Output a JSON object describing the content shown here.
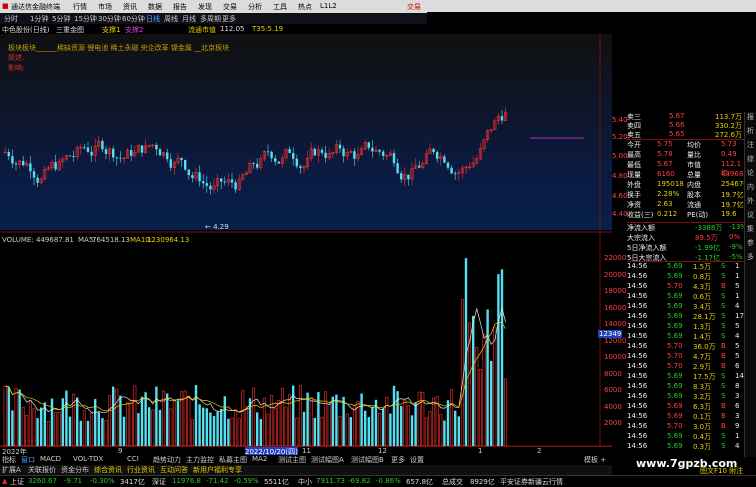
{
  "menubar": {
    "app": "通达信金融终端",
    "items": [
      "行情",
      "市场",
      "资讯",
      "数据",
      "报告",
      "发现",
      "交易",
      "分析",
      "工具",
      "热点",
      "L1L2"
    ],
    "right": "交易"
  },
  "toolbar": {
    "items": [
      "分时",
      "1分钟",
      "5分钟",
      "15分钟",
      "30分钟",
      "60分钟",
      "日线",
      "周线",
      "月线",
      "多周期",
      "更多"
    ]
  },
  "info": {
    "stock": "中色股份(日线)",
    "indicator": "三重金图",
    "b1": "支撑1",
    "b2": "支撑2",
    "mktval_label": "流通市值",
    "mktval": "112.05",
    "t35": "T35:5.19"
  },
  "note": {
    "l1": "板块板块______稀缺资源 锂电池 稀土永磁 央企改革 镍金属 __北京板块",
    "l2": "简述:",
    "l3": "影响:"
  },
  "price_axis": [
    "5.40",
    "5.20",
    "5.00",
    "4.80",
    "4.60",
    "4.40"
  ],
  "low_label": "← 4.29",
  "quote": {
    "asks": [
      [
        "卖三",
        "5.67",
        "113.7万"
      ],
      [
        "卖四",
        "5.66",
        "330.2万"
      ],
      [
        "卖五",
        "5.65",
        "272.6万"
      ]
    ],
    "rows": [
      [
        "今开",
        "5.75",
        "均价",
        "5.73"
      ],
      [
        "最高",
        "5.78",
        "量比",
        "0.49"
      ],
      [
        "最低",
        "5.67",
        "市值",
        "112.1亿"
      ],
      [
        "现量",
        "6160",
        "总量",
        "449688"
      ],
      [
        "外盘",
        "195018",
        "内盘",
        "254670"
      ],
      [
        "换手",
        "2.28%",
        "股本",
        "19.7亿"
      ],
      [
        "净资",
        "2.63",
        "流通",
        "19.7亿"
      ],
      [
        "收益(三)",
        "0.212",
        "PE(动)",
        "19.6"
      ]
    ]
  },
  "flow": [
    [
      "净流入额",
      "-3388万",
      "-13%"
    ],
    [
      "大宗流入",
      "89.5万",
      "0%"
    ],
    [
      "5日净流入额",
      "-1.99亿",
      "-9%"
    ],
    [
      "5日大宗流入",
      "-1.17亿",
      "-5%"
    ]
  ],
  "ticks": [
    [
      "14:56",
      "5.69",
      "1.5万",
      "S",
      "1"
    ],
    [
      "14:56",
      "5.69",
      "0.8万",
      "S",
      "1"
    ],
    [
      "14:56",
      "5.70",
      "4.3万",
      "B",
      "5"
    ],
    [
      "14:56",
      "5.69",
      "0.6万",
      "S",
      "1"
    ],
    [
      "14:56",
      "5.69",
      "3.4万",
      "S",
      "4"
    ],
    [
      "14:56",
      "5.69",
      "28.1万",
      "S",
      "17"
    ],
    [
      "14:56",
      "5.69",
      "1.3万",
      "S",
      "5"
    ],
    [
      "14:56",
      "5.69",
      "1.4万",
      "S",
      "4"
    ],
    [
      "14:56",
      "5.70",
      "36.0万",
      "B",
      "5"
    ],
    [
      "14:56",
      "5.70",
      "4.7万",
      "B",
      "5"
    ],
    [
      "14:56",
      "5.70",
      "2.9万",
      "B",
      "6"
    ],
    [
      "14:56",
      "5.69",
      "17.5万",
      "S",
      "14"
    ],
    [
      "14:56",
      "5.69",
      "8.3万",
      "S",
      "8"
    ],
    [
      "14:56",
      "5.69",
      "3.2万",
      "S",
      "3"
    ],
    [
      "14:56",
      "5.69",
      "6.3万",
      "B",
      "6"
    ],
    [
      "14:56",
      "5.69",
      "0.1万",
      "B",
      "3"
    ],
    [
      "14:56",
      "5.70",
      "3.0万",
      "B",
      "9"
    ],
    [
      "14:56",
      "5.69",
      "0.4万",
      "S",
      "1"
    ],
    [
      "14:56",
      "5.69",
      "0.3万",
      "S",
      "4"
    ]
  ],
  "vol": {
    "label": "VOLUME:",
    "v": "449687.81",
    "ma5l": "MA5:",
    "ma5": "764518.13",
    "ma10l": "MA10:",
    "ma10": "1230964.13"
  },
  "vol_axis": [
    "22000",
    "20000",
    "18000",
    "16000",
    "14000",
    "12000",
    "10000",
    "8000",
    "6000",
    "4000",
    "2000"
  ],
  "vol_marker": "12349",
  "xaxis": {
    "a": "2022年",
    "b": "9",
    "c": "10",
    "date": "2022/10/20(四)",
    "d": "11",
    "e": "12",
    "f": "1",
    "g": "2"
  },
  "tabs": [
    "指标",
    "窗口",
    "MACD",
    "VOL-TDX",
    "CCI",
    "趋势动力",
    "主力监控",
    "私募主图",
    "MA2",
    "测试主图",
    "测试幅图A",
    "测试幅图B",
    "更多",
    "设置"
  ],
  "tabs2": [
    "扩展A",
    "关联报价",
    "资金分布",
    "综合资讯",
    "行业资讯",
    "互动问答",
    "新用户福利专享"
  ],
  "tab_right": "模板 +",
  "status": {
    "sh": "上证",
    "shv": "3260.67",
    "shc": "-9.71",
    "shp": "-0.30%",
    "sha": "3417亿",
    "sz": "深证",
    "szv": "11976.8",
    "szc": "-71.42",
    "szp": "-0.59%",
    "sza": "5511亿",
    "zx": "中小",
    "zxv": "7911.73",
    "zxc": "-69.82",
    "zxp": "-0.86%",
    "zxa": "657.8亿",
    "zs": "总成交",
    "zsa": "8929亿",
    "broker": "平安证券新疆云行情"
  },
  "watermark": "www.7gpzb.com",
  "footnote": "图文F10 附注",
  "right_icons": [
    "报",
    "析",
    "注",
    "综",
    "论",
    "内",
    "外",
    "议",
    "集",
    "参",
    "多"
  ]
}
